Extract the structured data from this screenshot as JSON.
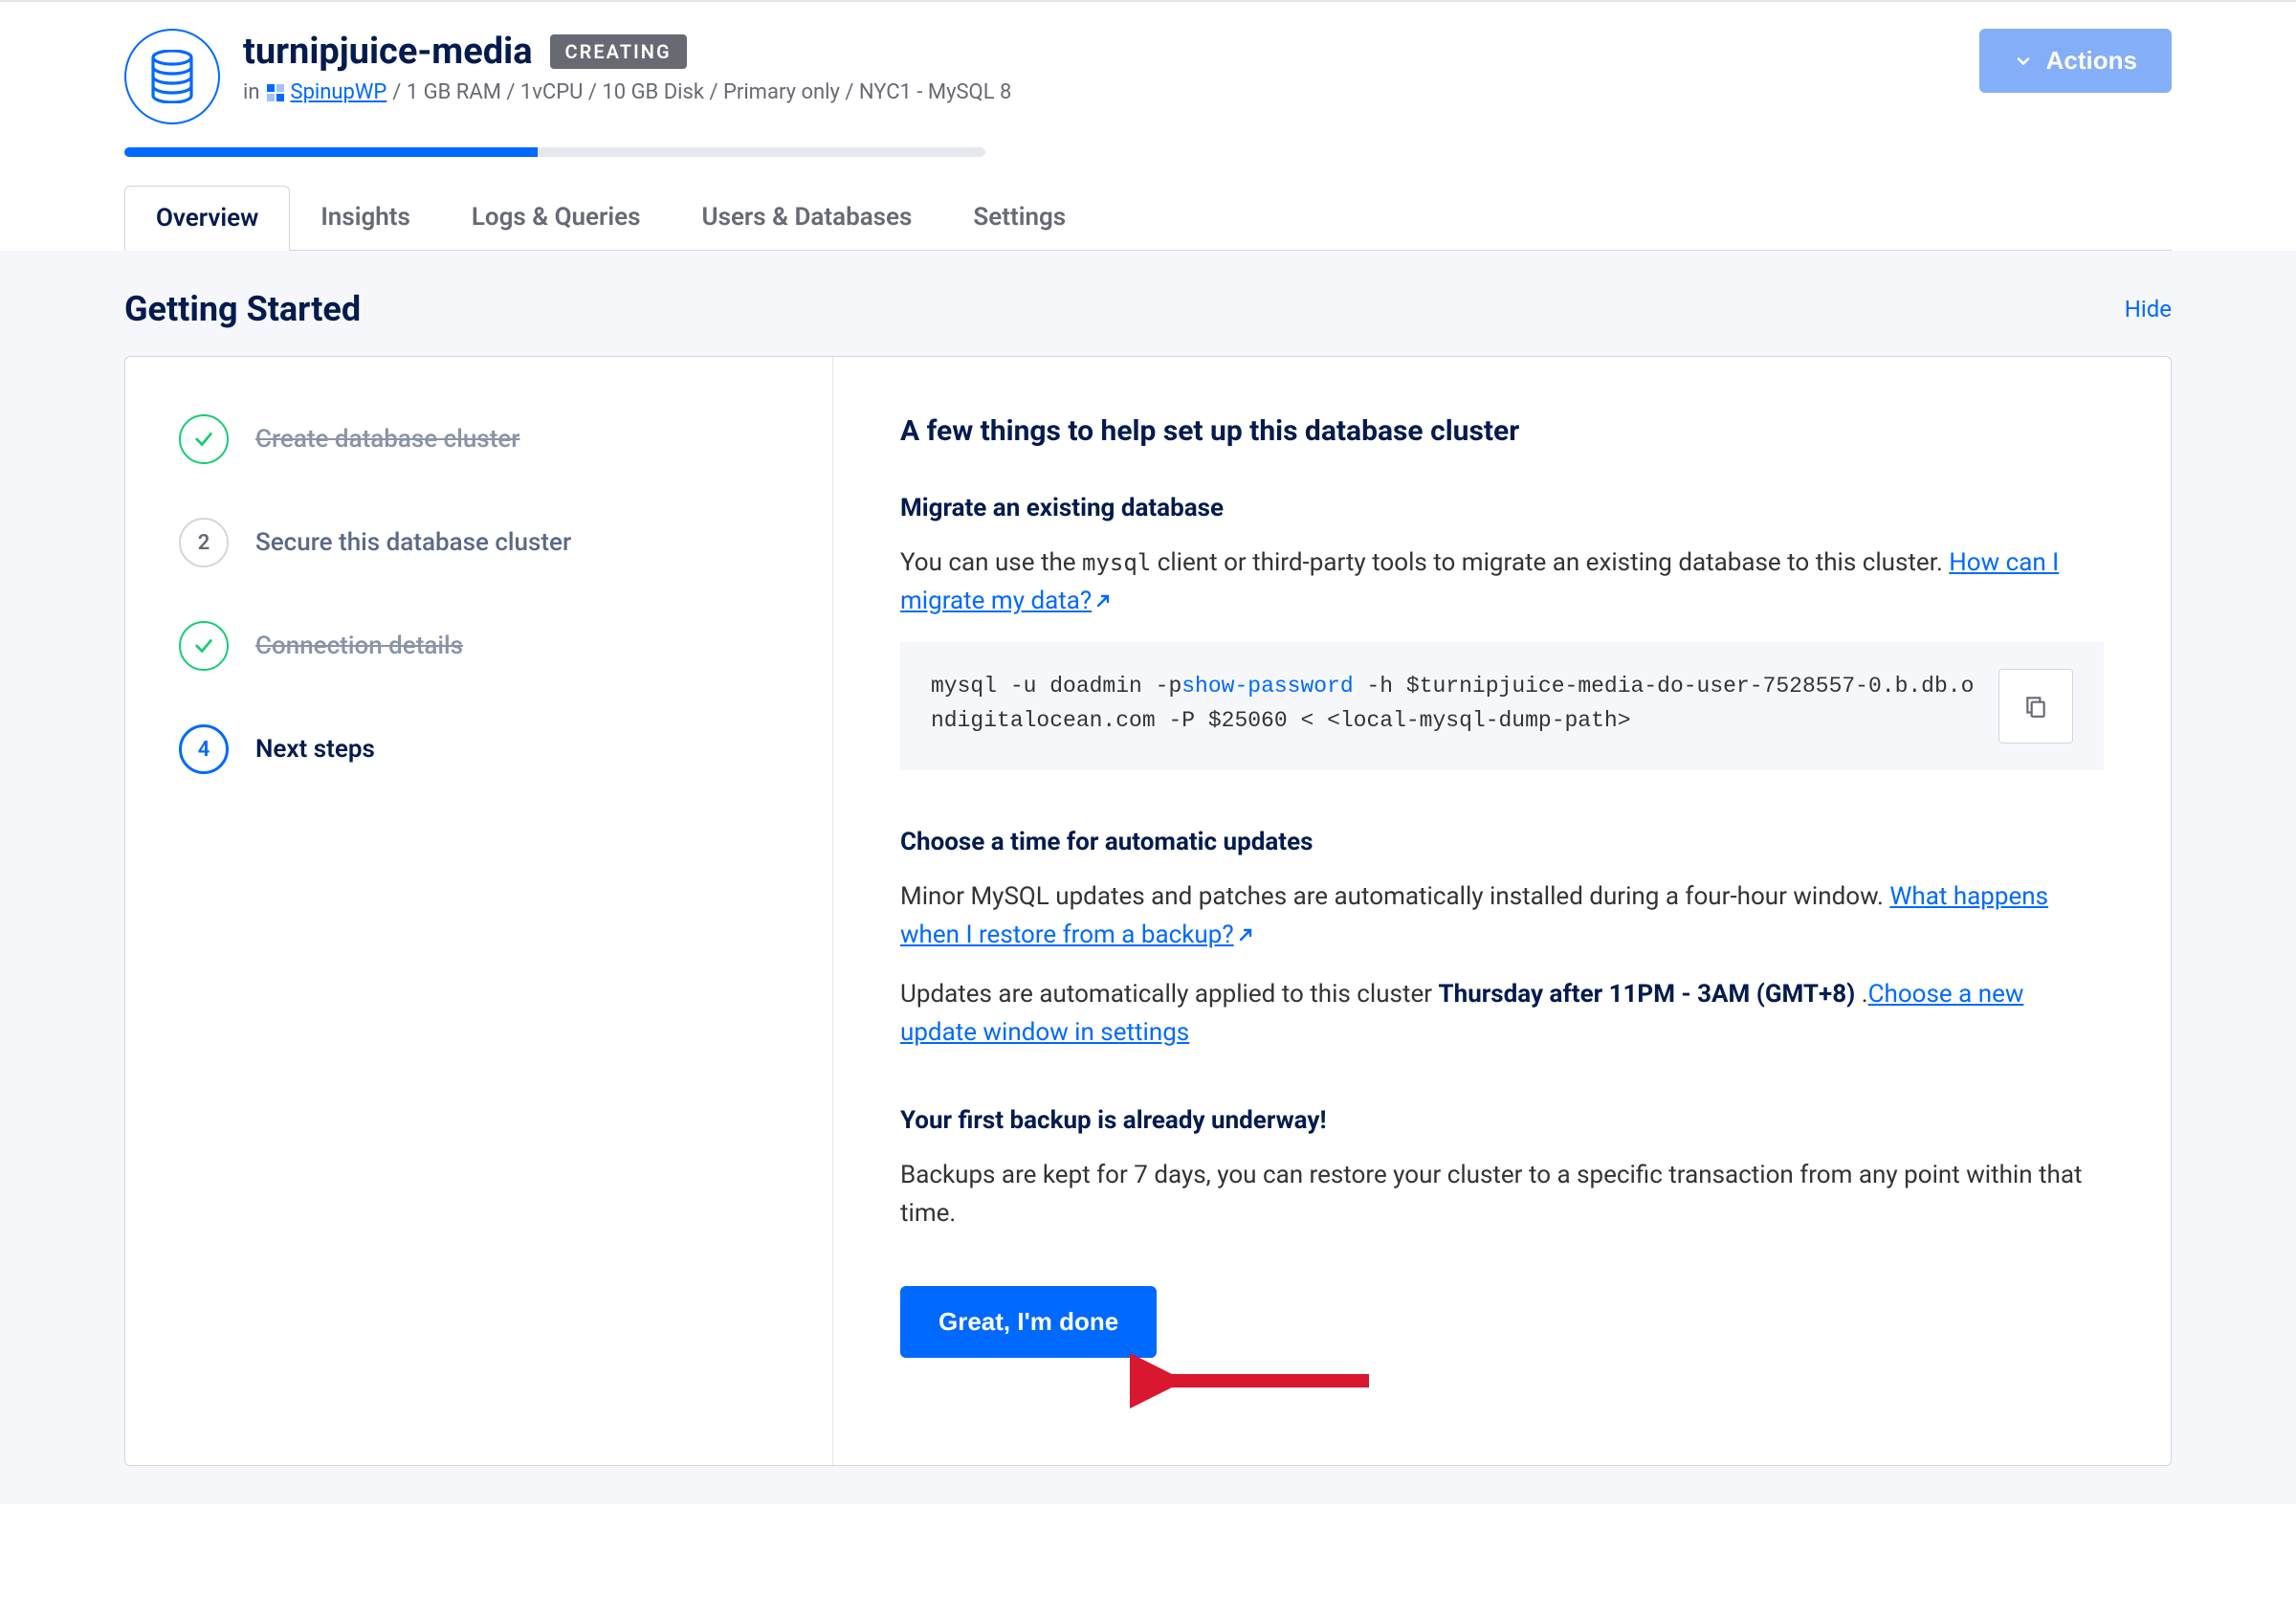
{
  "header": {
    "title": "turnipjuice-media",
    "status": "CREATING",
    "meta_prefix": "in",
    "project_link": "SpinupWP",
    "specs": " / 1 GB RAM / 1vCPU / 10 GB Disk / Primary only / NYC1 - MySQL 8",
    "actions_label": "Actions",
    "progress_percent": 48
  },
  "tabs": [
    {
      "label": "Overview",
      "active": true
    },
    {
      "label": "Insights",
      "active": false
    },
    {
      "label": "Logs & Queries",
      "active": false
    },
    {
      "label": "Users & Databases",
      "active": false
    },
    {
      "label": "Settings",
      "active": false
    }
  ],
  "section": {
    "title": "Getting Started",
    "hide": "Hide"
  },
  "steps": [
    {
      "label": "Create database cluster",
      "state": "done",
      "num": "1"
    },
    {
      "label": "Secure this database cluster",
      "state": "num",
      "num": "2"
    },
    {
      "label": "Connection details",
      "state": "done",
      "num": "3"
    },
    {
      "label": "Next steps",
      "state": "active",
      "num": "4"
    }
  ],
  "content": {
    "heading": "A few things to help set up this database cluster",
    "migrate": {
      "title": "Migrate an existing database",
      "text_pre": "You can use the ",
      "code_inline": "mysql",
      "text_post": " client or third-party tools to migrate an existing database to this cluster. ",
      "link": "How can I migrate my data?",
      "command_pre": "mysql -u doadmin -p",
      "command_show": "show-password",
      "command_post": " -h $turnipjuice-media-do-user-7528557-0.b.db.ondigitalocean.com -P $25060 < <local-mysql-dump-path>"
    },
    "updates": {
      "title": "Choose a time for automatic updates",
      "p1_pre": "Minor MySQL updates and patches are automatically installed during a four-hour window. ",
      "p1_link": "What happens when I restore from a backup?",
      "p2_pre": "Updates are automatically applied to this cluster ",
      "p2_bold": "Thursday after 11PM - 3AM (GMT+8)",
      "p2_post": " .",
      "p2_link": "Choose a new update window in settings"
    },
    "backup": {
      "title": "Your first backup is already underway!",
      "text": "Backups are kept for 7 days, you can restore your cluster to a specific transaction from any point within that time."
    },
    "done_button": "Great, I'm done"
  }
}
